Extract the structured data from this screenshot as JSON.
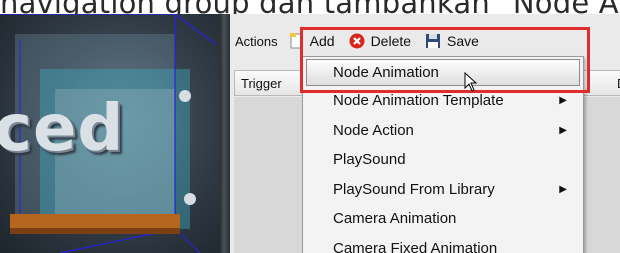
{
  "caption": "navigation group dan tambahkan \"Node Animation\"",
  "viewport": {
    "text": "ced"
  },
  "toolbar": {
    "actions_label": "Actions",
    "add_label": "Add",
    "delete_label": "Delete",
    "save_label": "Save"
  },
  "grid": {
    "header_trigger": "Trigger",
    "header_partial": "D"
  },
  "menu": {
    "items": [
      {
        "label": "Node Animation",
        "submenu": false,
        "active": true
      },
      {
        "label": "Node Animation Template",
        "submenu": true,
        "active": false
      },
      {
        "label": "Node Action",
        "submenu": true,
        "active": false
      },
      {
        "label": "PlaySound",
        "submenu": false,
        "active": false
      },
      {
        "label": "PlaySound From Library",
        "submenu": true,
        "active": false
      },
      {
        "label": "Camera Animation",
        "submenu": false,
        "active": false
      },
      {
        "label": "Camera Fixed Animation",
        "submenu": false,
        "active": false
      }
    ]
  },
  "colors": {
    "highlight": "#e02c2c",
    "delete_icon": "#d9261c",
    "save_icon": "#2e4a7a"
  },
  "icons": {
    "add": "new-file-icon",
    "delete": "delete-x-icon",
    "save": "floppy-disk-icon",
    "submenu": "submenu-arrow-icon",
    "cursor": "mouse-pointer-icon"
  }
}
